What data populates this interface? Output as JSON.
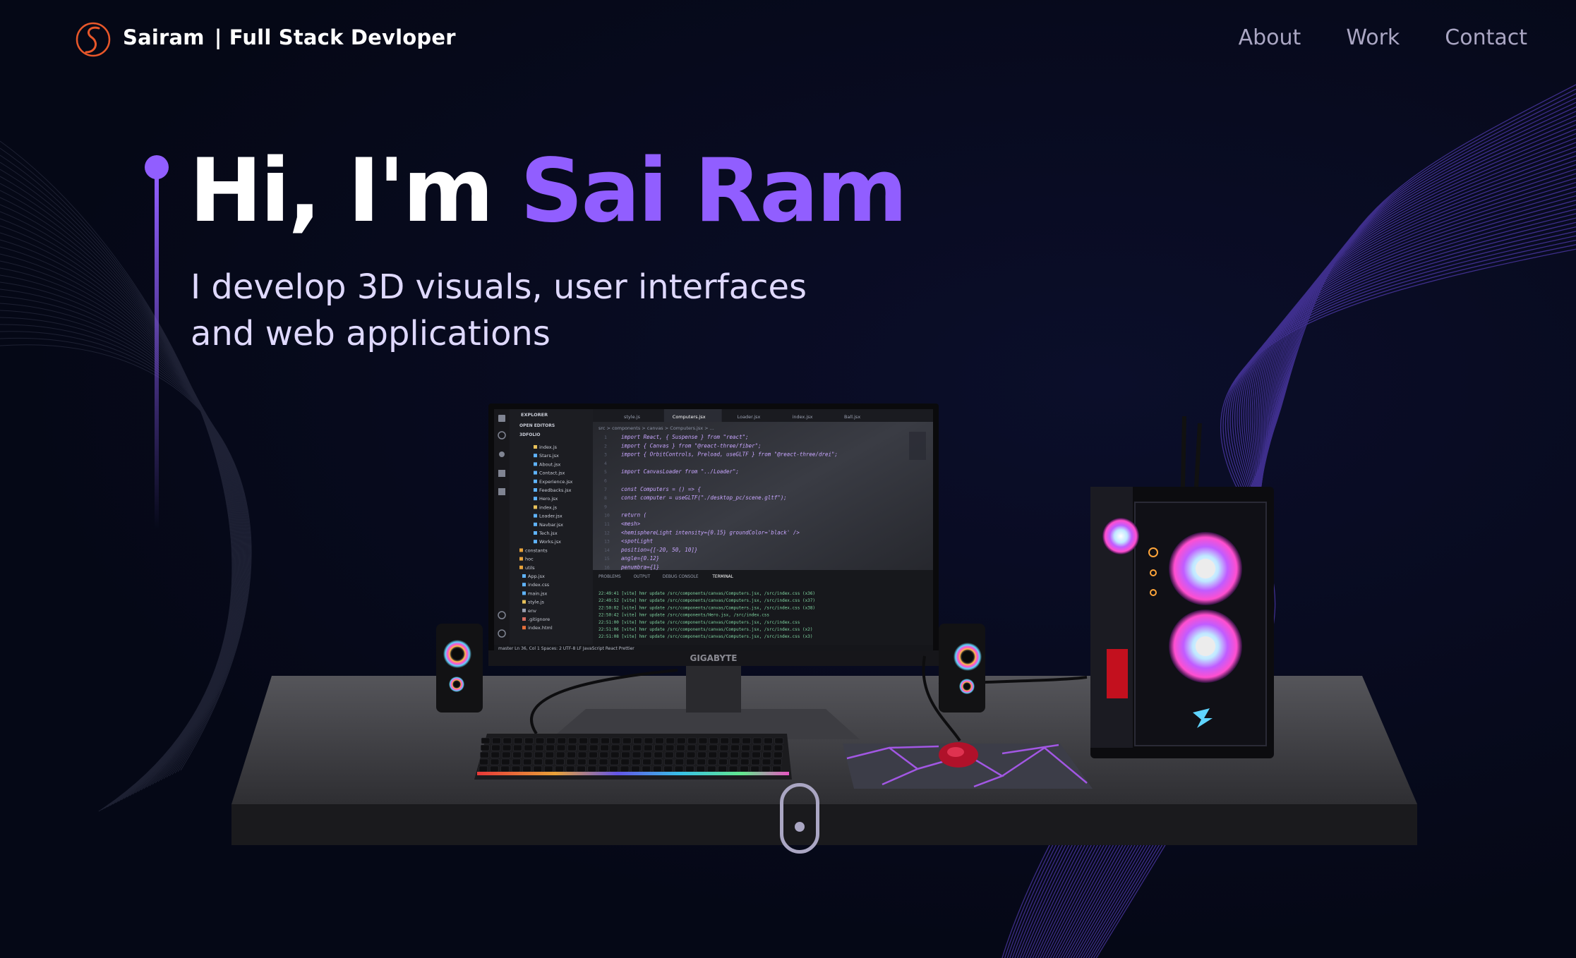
{
  "nav": {
    "brand_name": "Sairam",
    "brand_tagline": "| Full Stack Devloper",
    "links": [
      "About",
      "Work",
      "Contact"
    ]
  },
  "hero": {
    "greeting": "Hi, I'm ",
    "name": "Sai Ram",
    "subtitle": "I develop 3D visuals, user interfaces and web applications"
  },
  "monitor": {
    "brand": "GIGABYTE",
    "explorer_title": "EXPLORER",
    "open_editors": "OPEN EDITORS",
    "project": "3DFOLIO",
    "files": [
      "index.js",
      "Stars.jsx",
      "About.jsx",
      "Contact.jsx",
      "Experience.jsx",
      "Feedbacks.jsx",
      "Hero.jsx",
      "index.js",
      "Loader.jsx",
      "Navbar.jsx",
      "Tech.jsx",
      "Works.jsx",
      "constants",
      "hoc",
      "utils",
      "App.jsx",
      "index.css",
      "main.jsx",
      "style.js",
      "env",
      ".gitignore",
      "index.html"
    ],
    "tabs": [
      "style.js",
      "Computers.jsx",
      "Loader.jsx",
      "index.jsx",
      "Ball.jsx"
    ],
    "breadcrumb": "src > components > canvas > Computers.jsx > ...",
    "code_lines": [
      "import React, { Suspense } from \"react\";",
      "import { Canvas } from \"@react-three/fiber\";",
      "import { OrbitControls, Preload, useGLTF } from \"@react-three/drei\";",
      "",
      "import CanvasLoader from \"../Loader\";",
      "",
      "const Computers = () => {",
      "  const computer = useGLTF(\"./desktop_pc/scene.gltf\");",
      "",
      "  return (",
      "    <mesh>",
      "      <hemisphereLight intensity={0.15} groundColor='black' />",
      "      <spotLight",
      "        position={[-20, 50, 10]}",
      "        angle={0.12}",
      "        penumbra={1}"
    ],
    "panel_tabs": [
      "PROBLEMS",
      "OUTPUT",
      "DEBUG CONSOLE",
      "TERMINAL"
    ],
    "terminal_lines": [
      "22:49:41 [vite] hmr update /src/components/canvas/Computers.jsx, /src/index.css (x36)",
      "22:49:52 [vite] hmr update /src/components/canvas/Computers.jsx, /src/index.css (x37)",
      "22:50:02 [vite] hmr update /src/components/canvas/Computers.jsx, /src/index.css (x38)",
      "22:50:42 [vite] hmr update /src/components/Hero.jsx, /src/index.css",
      "22:51:00 [vite] hmr update /src/components/canvas/Computers.jsx, /src/index.css",
      "22:51:06 [vite] hmr update /src/components/canvas/Computers.jsx, /src/index.css (x2)",
      "22:51:08 [vite] hmr update /src/components/canvas/Computers.jsx, /src/index.css (x3)"
    ],
    "status_bar": "master  Ln 36, Col 1  Spaces: 2  UTF-8  LF  JavaScript React  Prettier"
  },
  "colors": {
    "background": "#050816",
    "accent": "#915eff",
    "nav_text": "#aaa6c3",
    "subtitle": "#dfd9ff"
  },
  "icons": [
    "logo-s-icon",
    "scroll-indicator-icon"
  ]
}
